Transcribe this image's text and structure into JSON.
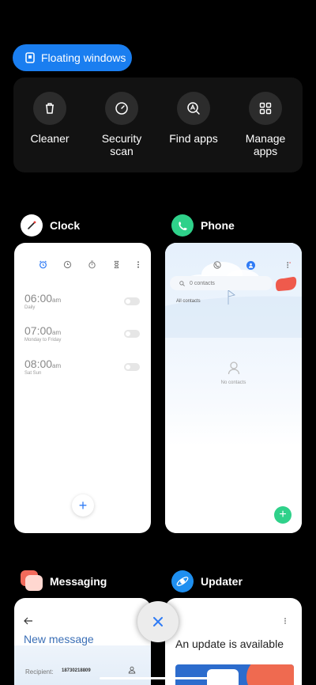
{
  "floating_windows": {
    "label": "Floating windows"
  },
  "tools": [
    {
      "label": "Cleaner",
      "icon": "trash-icon"
    },
    {
      "label": "Security\nscan",
      "icon": "security-icon"
    },
    {
      "label": "Find apps",
      "icon": "find-apps-icon"
    },
    {
      "label": "Manage\napps",
      "icon": "grid-icon"
    }
  ],
  "apps": {
    "clock": {
      "name": "Clock",
      "alarms": [
        {
          "time": "06:00",
          "suffix": "am",
          "sub": "Daily"
        },
        {
          "time": "07:00",
          "suffix": "am",
          "sub": "Monday to Friday"
        },
        {
          "time": "08:00",
          "suffix": "am",
          "sub": "Sat Sun"
        }
      ],
      "fab": "+"
    },
    "phone": {
      "name": "Phone",
      "search_placeholder": "0 contacts",
      "tab_label": "All contacts",
      "empty_text": "No contacts",
      "fab": "+"
    },
    "messaging": {
      "name": "Messaging",
      "title": "New message",
      "recipient_label": "Recipient:",
      "recipient_value": "18730218809"
    },
    "updater": {
      "name": "Updater",
      "title": "An update is available"
    }
  },
  "colors": {
    "accent": "#1a7ef0",
    "phone_green": "#2fd18a",
    "messaging_red": "#f26a5b",
    "updater_blue": "#1e8ff0"
  }
}
